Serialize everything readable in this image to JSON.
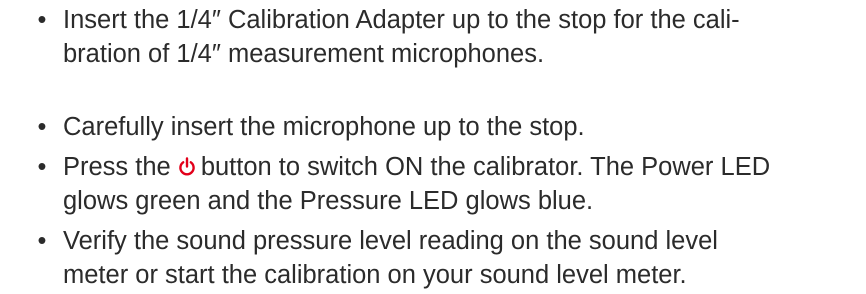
{
  "instructions": {
    "bullet_glyph": "•",
    "step1": {
      "line1": "Insert the 1/4″ Calibration Adapter up to the stop for the cali-",
      "line2": "bration of 1/4″ measurement microphones."
    },
    "step2": {
      "line1": "Carefully insert the microphone up to the stop."
    },
    "step3": {
      "prefix": "Press the",
      "icon": "power-icon",
      "icon_color": "#e2001a",
      "line1_rest": "button to switch ON the calibrator. The Power LED",
      "line2": "glows green and the Pressure LED glows blue."
    },
    "step4": {
      "line1": "Verify the sound pressure level reading on the sound level",
      "line2": "meter or start the calibration on your sound level meter."
    }
  }
}
